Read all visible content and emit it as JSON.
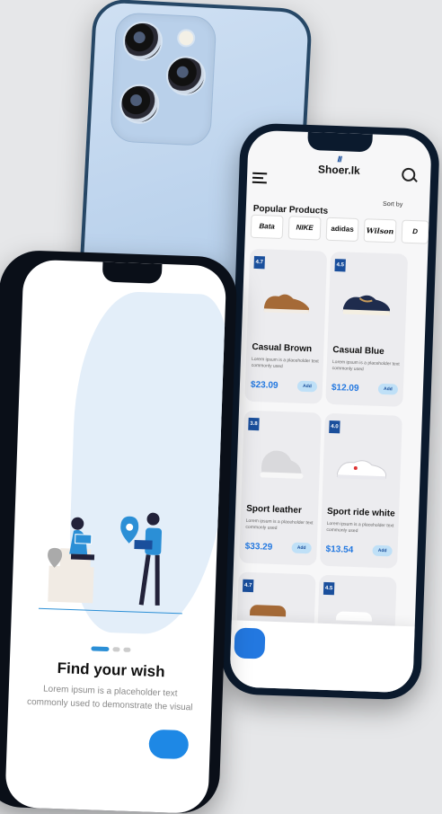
{
  "onboarding": {
    "title": "Find your wish",
    "description": "Lorem ipsum is a placeholder text commonly used  to demonstrate the visual",
    "next_icon": "arrow-right-icon",
    "page_dots": 3,
    "active_dot": 0
  },
  "shop": {
    "app_name": "Shoer.lk",
    "menu_icon": "hamburger-menu-icon",
    "search_icon": "search-icon",
    "section_title": "Popular Products",
    "sort_label": "Sort by",
    "brands": [
      "Bata",
      "NIKE",
      "adidas",
      "Wilson",
      "D"
    ],
    "products": [
      {
        "rating": "4.7",
        "name": "Casual Brown",
        "desc": "Lorem ipsum is a placeholder text commonly used",
        "price": "$23.09",
        "add_label": "Add"
      },
      {
        "rating": "4.5",
        "name": "Casual Blue",
        "desc": "Lorem ipsum is a placeholder text commonly used",
        "price": "$12.09",
        "add_label": "Add"
      },
      {
        "rating": "3.8",
        "name": "Sport leather",
        "desc": "Lorem ipsum is a placeholder text commonly used",
        "price": "$33.29",
        "add_label": "Add"
      },
      {
        "rating": "4.0",
        "name": "Sport ride white",
        "desc": "Lorem ipsum is a placeholder text commonly used",
        "price": "$13.54",
        "add_label": "Add"
      },
      {
        "rating": "4.7"
      },
      {
        "rating": "4.5"
      }
    ],
    "bottom_nav": [
      "home-icon",
      "heart-icon",
      "cart-icon",
      "profile-icon"
    ]
  },
  "colors": {
    "accent": "#2378e0",
    "dark_blue": "#1a4f9c",
    "frame": "#0b1a2d",
    "illustration": "#2b8fd6"
  }
}
